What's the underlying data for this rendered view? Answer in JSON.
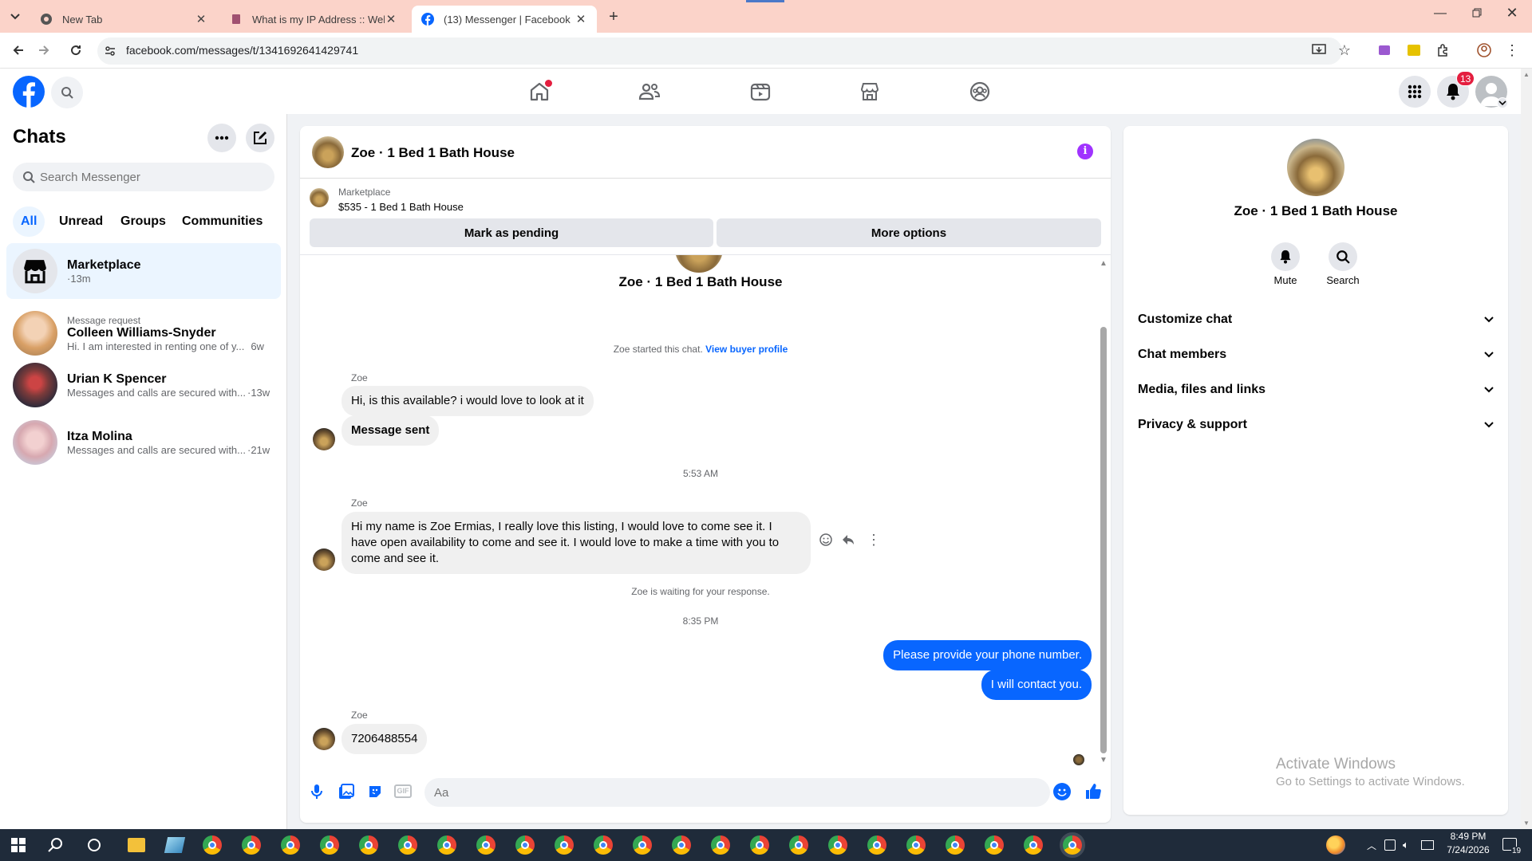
{
  "browser": {
    "tabs": [
      {
        "title": "New Tab"
      },
      {
        "title": "What is my IP Address :: WebB"
      },
      {
        "title": "(13) Messenger | Facebook"
      }
    ],
    "url": "facebook.com/messages/t/1341692641429741"
  },
  "header": {
    "notification_count": "13",
    "nav": [
      "home-icon",
      "friends-icon",
      "video-icon",
      "marketplace-icon",
      "groups-icon"
    ]
  },
  "sidebar": {
    "title": "Chats",
    "search_placeholder": "Search Messenger",
    "filters": [
      "All",
      "Unread",
      "Groups",
      "Communities"
    ],
    "chats": [
      {
        "name": "Marketplace",
        "preview": "",
        "time": "·13m",
        "request": ""
      },
      {
        "name": "Colleen Williams-Snyder",
        "preview": "Hi. I am interested in renting one of y...",
        "time": "6w",
        "request": "Message request"
      },
      {
        "name": "Urian K Spencer",
        "preview": "Messages and calls are secured with...",
        "time": "·13w",
        "request": ""
      },
      {
        "name": "Itza Molina",
        "preview": "Messages and calls are secured with...",
        "time": "·21w",
        "request": ""
      }
    ]
  },
  "conversation": {
    "title": "Zoe · 1 Bed 1 Bath House",
    "marketplace_label": "Marketplace",
    "listing": "$535 - 1 Bed 1 Bath House",
    "mark_pending": "Mark as pending",
    "more_options": "More options",
    "profile_name": "Zoe · 1 Bed 1 Bath House",
    "started_text": "Zoe started this chat.",
    "buyer_link": "View buyer profile",
    "sender": "Zoe",
    "msg1": "Hi, is this available? i would love to look at it",
    "msg2": "Message sent",
    "time1": "5:53 AM",
    "msg3": "Hi my name is Zoe Ermias, I really love this listing, I would love to come see it. I have open availability to come and see it. I would love to make a time with you to come and see it.",
    "waiting": "Zoe is waiting for your response.",
    "time2": "8:35 PM",
    "out1": "Please provide your phone number.",
    "out2": "I will contact you.",
    "msg4": "7206488554",
    "composer_placeholder": "Aa"
  },
  "details": {
    "name": "Zoe · 1 Bed 1 Bath House",
    "mute": "Mute",
    "search": "Search",
    "sections": [
      "Customize chat",
      "Chat members",
      "Media, files and links",
      "Privacy & support"
    ]
  },
  "watermark": {
    "line1": "Activate Windows",
    "line2": "Go to Settings to activate Windows."
  },
  "taskbar": {
    "time": "8:49 PM",
    "date": "7/24/2026",
    "badge": "19"
  },
  "colors": {
    "accent": "#0866ff",
    "tabbar": "#fbd3c9",
    "badge": "#e41e3f",
    "purple": "#a033ff"
  }
}
